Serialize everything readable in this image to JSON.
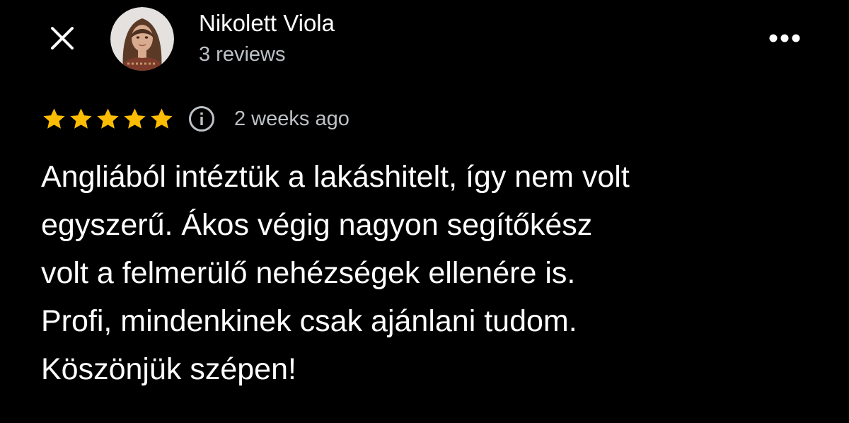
{
  "header": {
    "close_icon": "close-icon",
    "avatar_icon": "avatar",
    "more_icon": "more-horizontal-icon"
  },
  "reviewer": {
    "name": "Nikolett Viola",
    "review_count_text": "3 reviews"
  },
  "review": {
    "rating": 5,
    "max_rating": 5,
    "star_color": "#fbbc04",
    "info_icon": "info-icon",
    "time": "2 weeks ago",
    "text_lines": [
      "Angliából intéztük a lakáshitelt, így nem volt",
      "egyszerű. Ákos végig nagyon segítőkész",
      "volt a felmerülő nehézségek ellenére is.",
      "Profi, mindenkinek csak ajánlani tudom.",
      "Köszönjük szépen!"
    ]
  },
  "colors": {
    "background": "#000000",
    "primary_text": "#ffffff",
    "secondary_text": "#bdc1c6"
  }
}
